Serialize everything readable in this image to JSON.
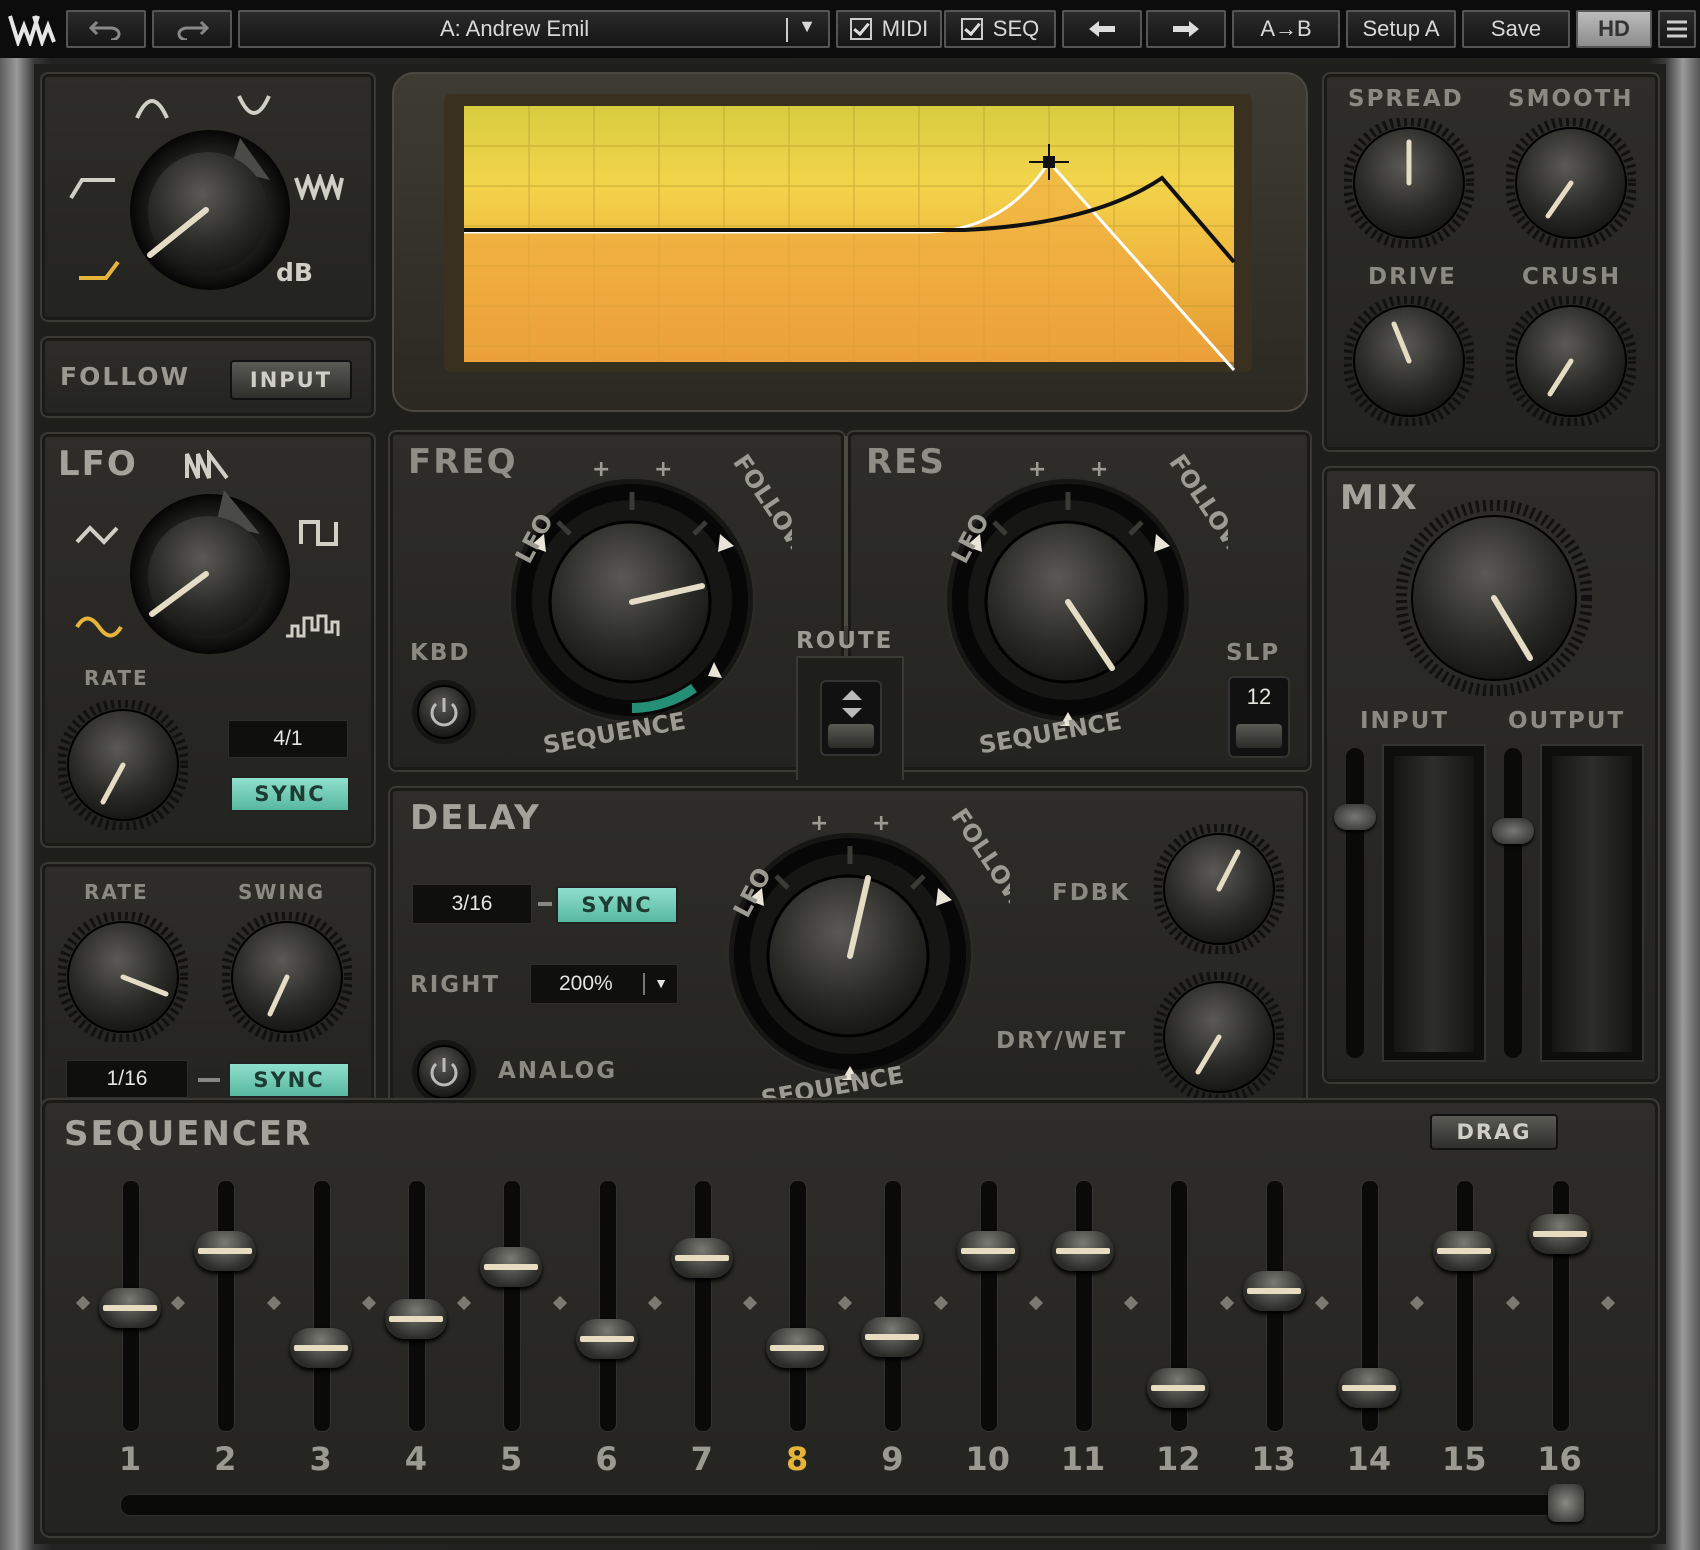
{
  "toolbar": {
    "preset_name": "A: Andrew Emil",
    "midi_label": "MIDI",
    "seq_label": "SEQ",
    "ab_label": "A→B",
    "setup_label": "Setup A",
    "save_label": "Save",
    "hd_label": "HD"
  },
  "filter_type": {
    "label_db": "dB"
  },
  "follow": {
    "label": "FOLLOW",
    "input_button": "INPUT"
  },
  "lfo": {
    "label": "LFO",
    "rate_label": "RATE",
    "rate_value": "4/1",
    "sync_label": "SYNC"
  },
  "seq_rate": {
    "rate_label": "RATE",
    "swing_label": "SWING",
    "rate_value": "1/16",
    "sync_label": "SYNC"
  },
  "freq": {
    "label": "FREQ",
    "kbd_label": "KBD",
    "lfo_arc": "LFO",
    "follow_arc": "FOLLOW",
    "sequence_arc": "SEQUENCE"
  },
  "res": {
    "label": "RES",
    "slp_label": "SLP",
    "slp_value": "12",
    "lfo_arc": "LFO",
    "follow_arc": "FOLLOW",
    "sequence_arc": "SEQUENCE"
  },
  "route": {
    "label": "ROUTE"
  },
  "delay": {
    "label": "DELAY",
    "time_value": "3/16",
    "sync_label": "SYNC",
    "right_label": "RIGHT",
    "right_value": "200%",
    "analog_label": "ANALOG",
    "fdbk_label": "FDBK",
    "drywet_label": "DRY/WET",
    "lfo_arc": "LFO",
    "follow_arc": "FOLLOW",
    "sequence_arc": "SEQUENCE"
  },
  "fx": {
    "spread_label": "SPREAD",
    "smooth_label": "SMOOTH",
    "drive_label": "DRIVE",
    "crush_label": "CRUSH"
  },
  "mix": {
    "label": "MIX",
    "input_label": "INPUT",
    "output_label": "OUTPUT"
  },
  "sequencer": {
    "label": "SEQUENCER",
    "drag_label": "DRAG",
    "active_step": 8,
    "steps": [
      {
        "n": "1",
        "level": 0.48
      },
      {
        "n": "2",
        "level": 0.74
      },
      {
        "n": "3",
        "level": 0.3
      },
      {
        "n": "4",
        "level": 0.43
      },
      {
        "n": "5",
        "level": 0.67
      },
      {
        "n": "6",
        "level": 0.34
      },
      {
        "n": "7",
        "level": 0.71
      },
      {
        "n": "8",
        "level": 0.3
      },
      {
        "n": "9",
        "level": 0.35
      },
      {
        "n": "10",
        "level": 0.74
      },
      {
        "n": "11",
        "level": 0.74
      },
      {
        "n": "12",
        "level": 0.12
      },
      {
        "n": "13",
        "level": 0.56
      },
      {
        "n": "14",
        "level": 0.12
      },
      {
        "n": "15",
        "level": 0.74
      },
      {
        "n": "16",
        "level": 0.82
      }
    ]
  }
}
